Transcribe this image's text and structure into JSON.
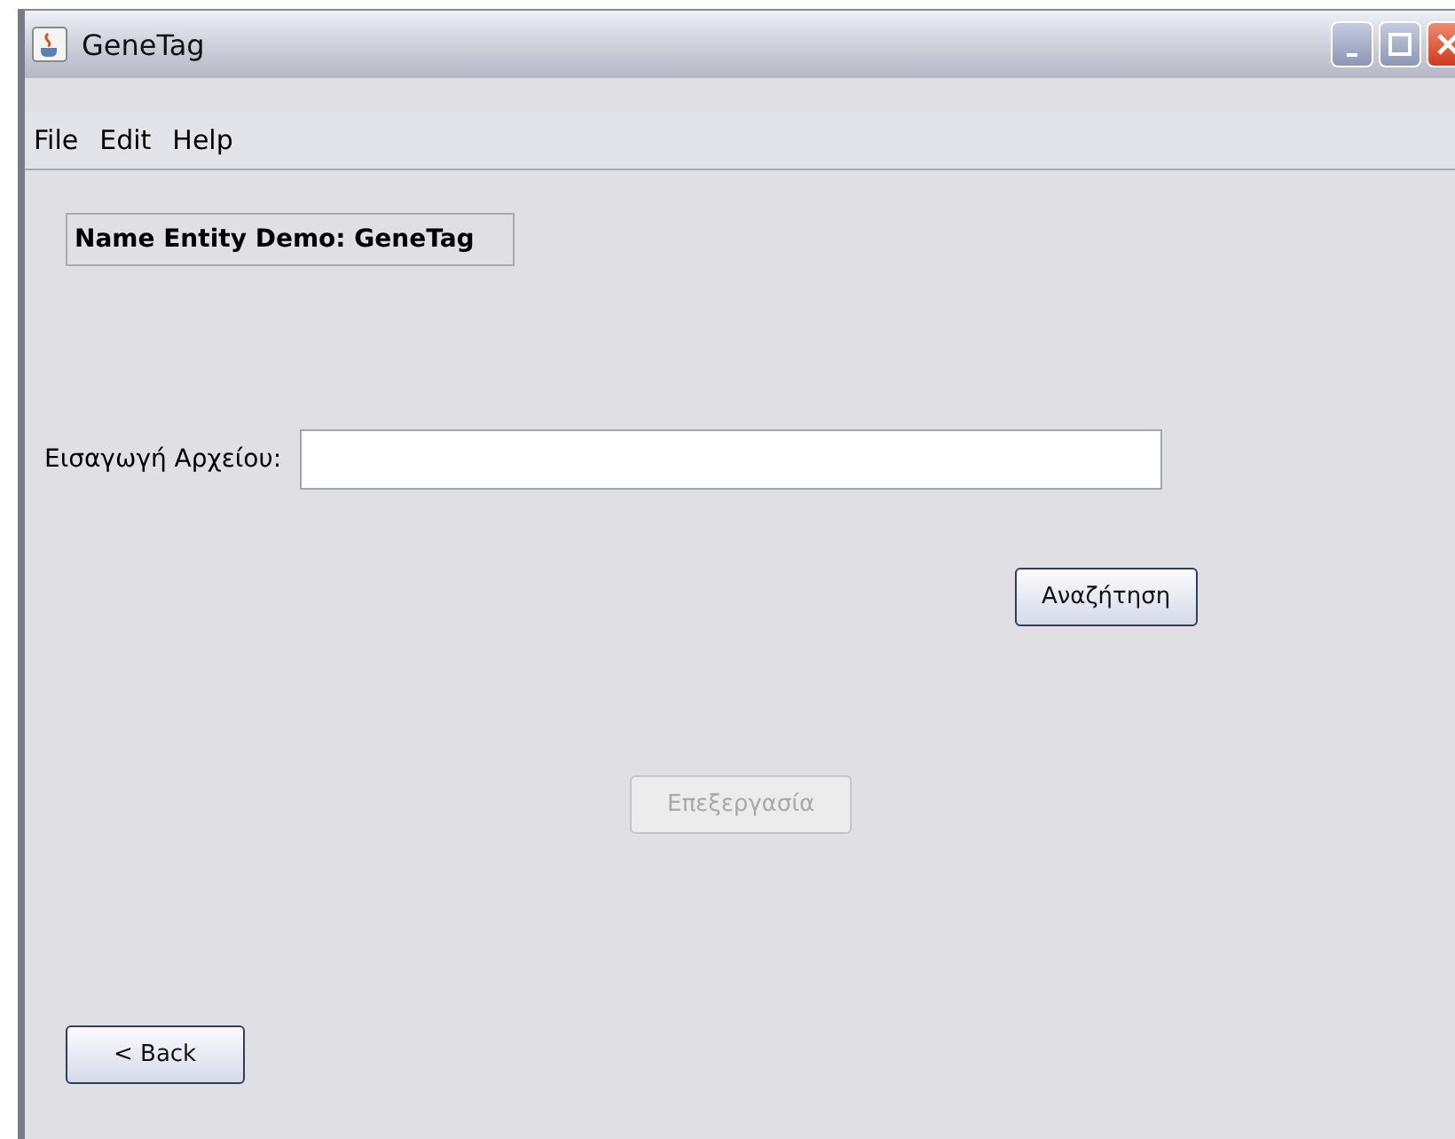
{
  "window": {
    "title": "GeneTag"
  },
  "menu": [
    "File",
    "Edit",
    "Help"
  ],
  "heading": "Name Entity Demo: GeneTag",
  "file_field": {
    "label": "Εισαγωγή Αρχείου:"
  },
  "buttons": [
    {
      "label": "Αναζήτηση",
      "disabled": false
    },
    {
      "label": "Επεξεργασία",
      "disabled": true
    },
    {
      "label": "< Back",
      "disabled": false
    }
  ]
}
